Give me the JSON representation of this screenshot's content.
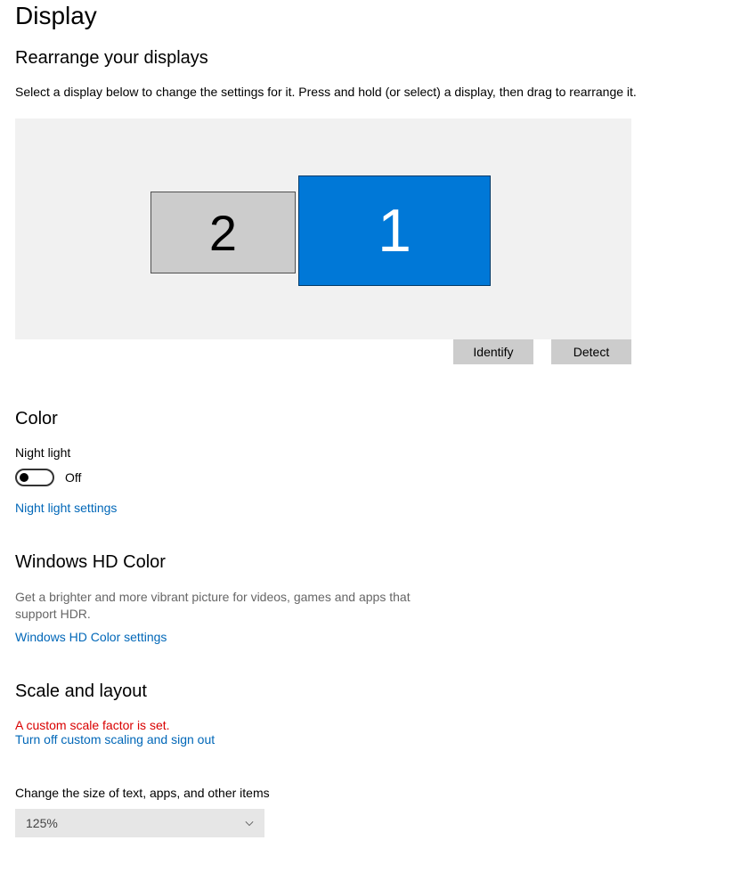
{
  "page": {
    "title": "Display"
  },
  "rearrange": {
    "heading": "Rearrange your displays",
    "help": "Select a display below to change the settings for it. Press and hold (or select) a display, then drag to rearrange it.",
    "monitors": {
      "secondary": "2",
      "primary": "1"
    },
    "buttons": {
      "identify": "Identify",
      "detect": "Detect"
    }
  },
  "color": {
    "heading": "Color",
    "night_light_label": "Night light",
    "night_light_state": "Off",
    "night_light_link": "Night light settings"
  },
  "hdr": {
    "heading": "Windows HD Color",
    "desc": "Get a brighter and more vibrant picture for videos, games and apps that support HDR.",
    "link": "Windows HD Color settings"
  },
  "scale": {
    "heading": "Scale and layout",
    "warning": "A custom scale factor is set.",
    "turn_off_link": "Turn off custom scaling and sign out",
    "size_label": "Change the size of text, apps, and other items",
    "size_value": "125%"
  }
}
